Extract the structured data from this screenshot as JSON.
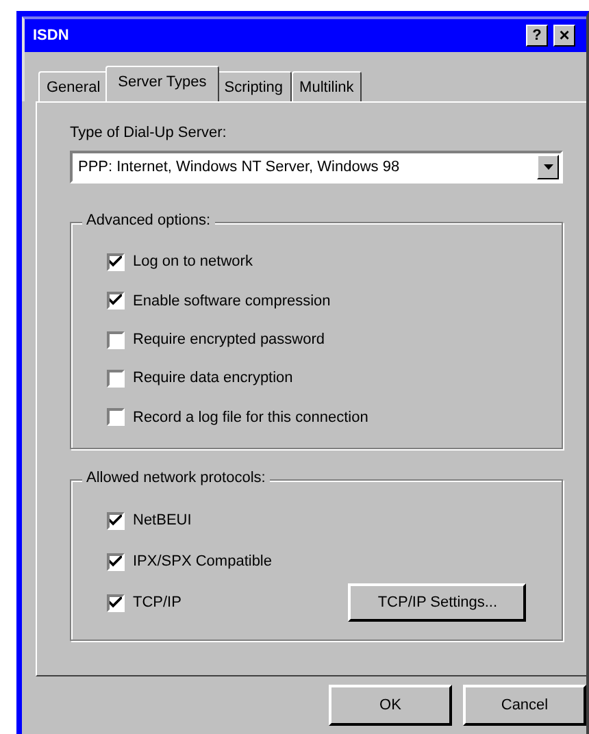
{
  "window": {
    "title": "ISDN"
  },
  "title_buttons": [
    {
      "kind": "help",
      "label": "?"
    },
    {
      "kind": "close",
      "label": "×"
    }
  ],
  "tabs": [
    {
      "label": "General",
      "selected": false
    },
    {
      "label": "Server Types",
      "selected": true
    },
    {
      "label": "Scripting",
      "selected": false
    },
    {
      "label": "Multilink",
      "selected": false
    }
  ],
  "server_type": {
    "label": "Type of Dial-Up Server:",
    "value": "PPP: Internet, Windows NT Server, Windows 98"
  },
  "advanced_options": {
    "title": "Advanced options:",
    "items": [
      {
        "label": "Log on to network",
        "checked": true
      },
      {
        "label": "Enable software compression",
        "checked": true
      },
      {
        "label": "Require encrypted password",
        "checked": false
      },
      {
        "label": "Require data encryption",
        "checked": false
      },
      {
        "label": "Record a log file for this connection",
        "checked": false
      }
    ]
  },
  "protocols": {
    "title": "Allowed network protocols:",
    "items": [
      {
        "label": "NetBEUI",
        "checked": true
      },
      {
        "label": "IPX/SPX Compatible",
        "checked": true
      },
      {
        "label": "TCP/IP",
        "checked": true
      }
    ],
    "settings_button": "TCP/IP Settings..."
  },
  "buttons": [
    "OK",
    "Cancel"
  ]
}
